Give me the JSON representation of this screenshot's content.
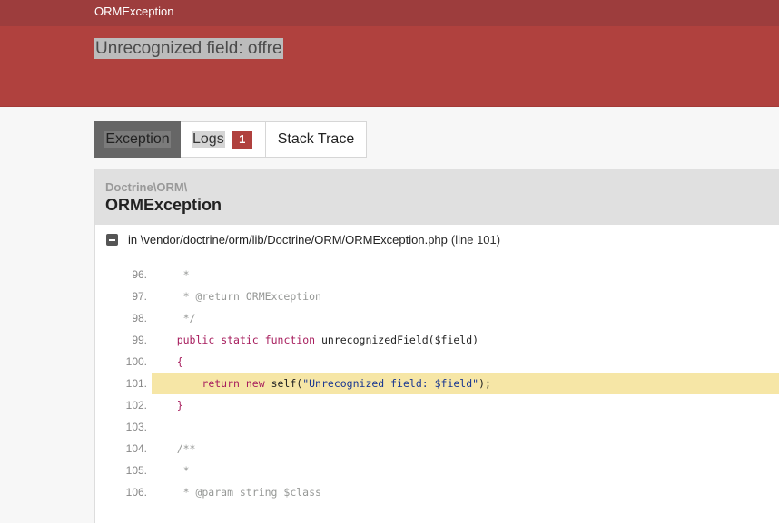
{
  "topbar": {
    "brand": "ORMException"
  },
  "header": {
    "title": "Unrecognized field: offre"
  },
  "tabs": [
    {
      "label": "Exception"
    },
    {
      "label": "Logs",
      "badge": "1"
    },
    {
      "label": "Stack Trace"
    }
  ],
  "exception": {
    "namespace": "Doctrine\\ORM\\",
    "class": "ORMException",
    "file_prefix": "in",
    "file_path": "\\vendor/doctrine/orm/lib/Doctrine/ORM/ORMException.php",
    "file_line": "(line 101)"
  },
  "code_lines": [
    {
      "num": "96.",
      "text": "     *"
    },
    {
      "num": "97.",
      "text": "     * @return ORMException"
    },
    {
      "num": "98.",
      "text": "     */"
    },
    {
      "num": "99.",
      "text": "    public static function unrecognizedField($field)"
    },
    {
      "num": "100.",
      "text": "    {"
    },
    {
      "num": "101.",
      "text": "        return new self(\"Unrecognized field: $field\");"
    },
    {
      "num": "102.",
      "text": "    }"
    },
    {
      "num": "103.",
      "text": ""
    },
    {
      "num": "104.",
      "text": "    /**"
    },
    {
      "num": "105.",
      "text": "     *"
    },
    {
      "num": "106.",
      "text": "     * @param string $class"
    }
  ],
  "highlighted_line": "101.",
  "colors": {
    "header": "#b0413e",
    "topbar": "#9d3d3d",
    "highlight": "#f6e6a6"
  }
}
